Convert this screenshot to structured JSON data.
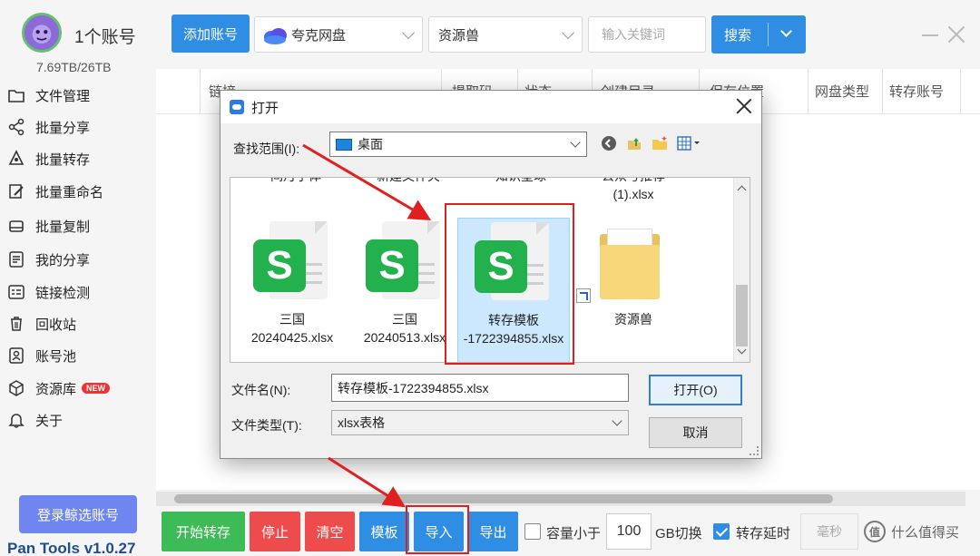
{
  "header": {
    "account_count": "1个账号",
    "storage": "7.69TB/26TB",
    "add_account": "添加账号",
    "cloud_select": "夸克网盘",
    "source_select": "资源兽",
    "keyword_placeholder": "输入关键词",
    "search": "搜索"
  },
  "sidebar": {
    "items": [
      {
        "label": "文件管理",
        "icon": "folder-icon"
      },
      {
        "label": "批量分享",
        "icon": "share-icon"
      },
      {
        "label": "批量转存",
        "icon": "transfer-icon"
      },
      {
        "label": "批量重命名",
        "icon": "rename-icon"
      },
      {
        "label": "批量复制",
        "icon": "copy-icon"
      },
      {
        "label": "我的分享",
        "icon": "my-share-icon"
      },
      {
        "label": "链接检测",
        "icon": "link-check-icon"
      },
      {
        "label": "回收站",
        "icon": "trash-icon"
      },
      {
        "label": "账号池",
        "icon": "account-pool-icon"
      },
      {
        "label": "资源库",
        "icon": "box-icon",
        "badge": "NEW"
      },
      {
        "label": "关于",
        "icon": "bell-icon"
      }
    ],
    "login_button": "登录鲸选账号",
    "version": "Pan Tools v1.0.27"
  },
  "table": {
    "columns": [
      "链接",
      "提取码",
      "状态",
      "创建目录",
      "保存位置",
      "网盘类型",
      "转存账号"
    ]
  },
  "toolbar": {
    "start": "开始转存",
    "stop": "停止",
    "clear": "清空",
    "template": "模板",
    "import": "导入",
    "export": "导出",
    "capacity_label": "容量小于",
    "capacity_value": "100",
    "gb_switch": "GB切换",
    "delay_label": "转存延时",
    "delay_checked": true,
    "capacity_checked": false,
    "ms": "毫秒"
  },
  "dialog": {
    "title": "打开",
    "look_in_label": "查找范围(I):",
    "look_in_value": "桌面",
    "cut_off_names": [
      "间月子体",
      "新建文件夹",
      "知识星球",
      "公众号推荐"
    ],
    "partial_name_line2": "(1).xlsx",
    "files": [
      {
        "line1": "三国",
        "line2": "20240425.xlsx"
      },
      {
        "line1": "三国",
        "line2": "20240513.xlsx"
      },
      {
        "line1": "转存模板",
        "line2": "-1722394855.xlsx",
        "selected": true
      },
      {
        "line1": "资源兽",
        "line2": ""
      }
    ],
    "filename_label": "文件名(N):",
    "filename_value": "转存模板-1722394855.xlsx",
    "filetype_label": "文件类型(T):",
    "filetype_value": "xlsx表格",
    "open_button": "打开(O)",
    "cancel_button": "取消"
  },
  "watermark": "什么值得买",
  "colors": {
    "primary_blue": "#2f8de4",
    "green": "#3dbb56",
    "red": "#ee4c4c",
    "annotation_red": "#e02020",
    "login_purple": "#6f86f0"
  }
}
